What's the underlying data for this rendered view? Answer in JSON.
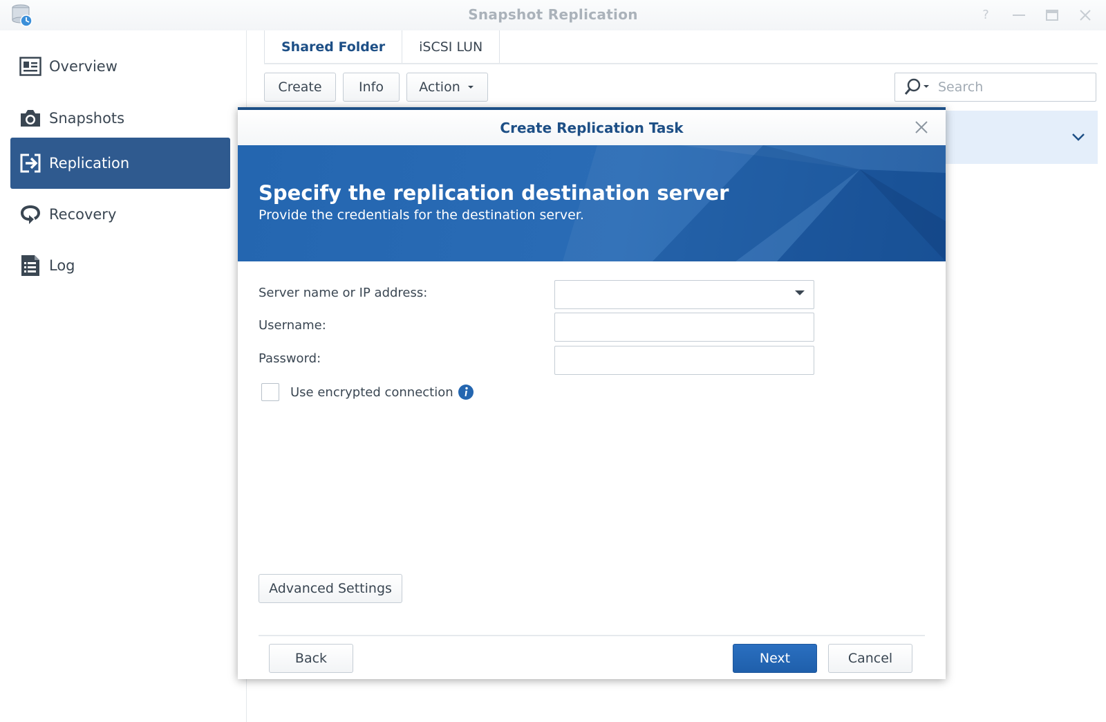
{
  "window": {
    "title": "Snapshot Replication",
    "controls": [
      "help-icon",
      "minimize-icon",
      "maximize-icon",
      "close-icon"
    ]
  },
  "sidebar": {
    "items": [
      {
        "label": "Overview",
        "icon": "overview-icon",
        "active": false
      },
      {
        "label": "Snapshots",
        "icon": "camera-icon",
        "active": false
      },
      {
        "label": "Replication",
        "icon": "replication-icon",
        "active": true
      },
      {
        "label": "Recovery",
        "icon": "recovery-icon",
        "active": false
      },
      {
        "label": "Log",
        "icon": "log-icon",
        "active": false
      }
    ]
  },
  "tabs": [
    {
      "label": "Shared Folder",
      "active": true
    },
    {
      "label": "iSCSI LUN",
      "active": false
    }
  ],
  "toolbar": {
    "create_label": "Create",
    "info_label": "Info",
    "action_label": "Action",
    "search_placeholder": "Search"
  },
  "dialog": {
    "title": "Create Replication Task",
    "banner_title": "Specify the replication destination server",
    "banner_subtitle": "Provide the credentials for the destination server.",
    "fields": {
      "server_label": "Server name or IP address:",
      "server_value": "",
      "username_label": "Username:",
      "username_value": "",
      "password_label": "Password:",
      "password_value": ""
    },
    "encrypted_label": "Use encrypted connection",
    "encrypted_checked": false,
    "advanced_label": "Advanced Settings",
    "back_label": "Back",
    "next_label": "Next",
    "cancel_label": "Cancel"
  },
  "colors": {
    "accent": "#1d4f86",
    "sidebar_active": "#2f5a8f",
    "primary_button": "#2466b0"
  }
}
